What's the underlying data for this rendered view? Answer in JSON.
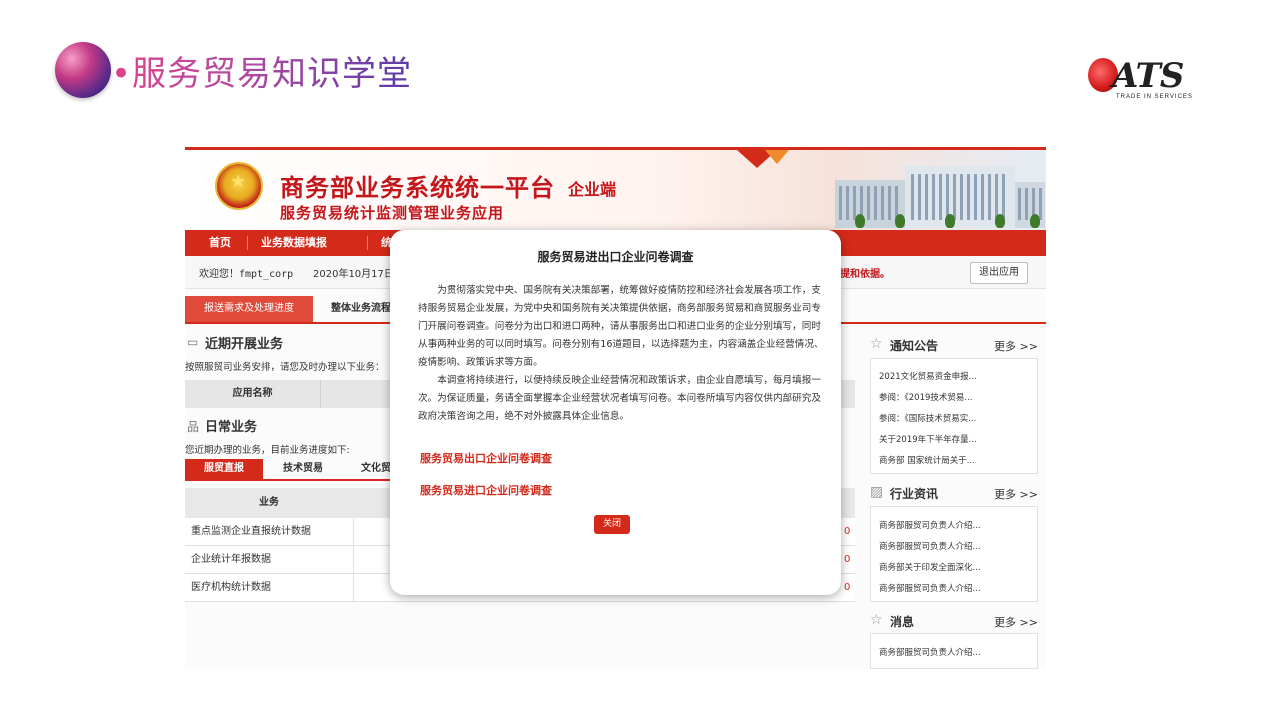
{
  "slide": {
    "title": "•服务贸易知识学堂",
    "logo": {
      "word": "ATS",
      "tagline": "TRADE IN SERVICES"
    }
  },
  "portal": {
    "platform_title": "商务部业务系统统一平台",
    "platform_suffix": "企业端",
    "platform_subtitle": "服务贸易统计监测管理业务应用",
    "nav": [
      "首页",
      "业务数据填报",
      "统"
    ],
    "welcome": "欢迎您！fmpt_corp",
    "date": "2020年10月17日 星",
    "red_note": "提和依据。",
    "logout": "退出应用",
    "tabs": [
      "报送需求及处理进度",
      "整体业务流程"
    ],
    "recent": {
      "title": "近期开展业务",
      "desc": "按照服贸司业务安排，请您及时办理以下业务：",
      "col_header": "应用名称"
    },
    "daily": {
      "title": "日常业务",
      "desc": "您近期办理的业务，目前业务进度如下:",
      "subtabs": [
        "服贸直报",
        "技术贸易",
        "文化贸"
      ],
      "col_header": "业务",
      "rows": [
        {
          "name": "重点监测企业直报统计数据",
          "count": "0"
        },
        {
          "name": "企业统计年报数据",
          "count": "0"
        },
        {
          "name": "医疗机构统计数据",
          "count": "0"
        }
      ]
    },
    "notice": {
      "title": "通知公告",
      "more": "更多 >>",
      "items": [
        "2021文化贸易资金申报...",
        "参阅：《2019技术贸易...",
        "参阅：《国际技术贸易实...",
        "关于2019年下半年存量...",
        "商务部 国家统计局关于..."
      ]
    },
    "industry": {
      "title": "行业资讯",
      "more": "更多 >>",
      "items": [
        "商务部服贸司负责人介绍...",
        "商务部服贸司负责人介绍...",
        "商务部关于印发全面深化...",
        "商务部服贸司负责人介绍..."
      ]
    },
    "messages": {
      "title": "消息",
      "more": "更多 >>",
      "items": [
        "商务部服贸司负责人介绍..."
      ]
    }
  },
  "modal": {
    "title": "服务贸易进出口企业问卷调查",
    "para1": "为贯彻落实党中央、国务院有关决策部署，统筹做好疫情防控和经济社会发展各项工作，支持服务贸易企业发展，为党中央和国务院有关决策提供依据，商务部服务贸易和商贸服务业司专门开展问卷调查。问卷分为出口和进口两种，请从事服务出口和进口业务的企业分别填写，同时从事两种业务的可以同时填写。问卷分别有16道题目，以选择题为主，内容涵盖企业经营情况、疫情影响、政策诉求等方面。",
    "para2": "本调查将持续进行，以便持续反映企业经营情况和政策诉求，由企业自愿填写，每月填报一次。为保证质量，务请全面掌握本企业经营状况者填写问卷。本问卷所填写内容仅供内部研究及政府决策咨询之用，绝不对外披露具体企业信息。",
    "link_export": "服务贸易出口企业问卷调查",
    "link_import": "服务贸易进口企业问卷调查",
    "close": "关闭"
  }
}
